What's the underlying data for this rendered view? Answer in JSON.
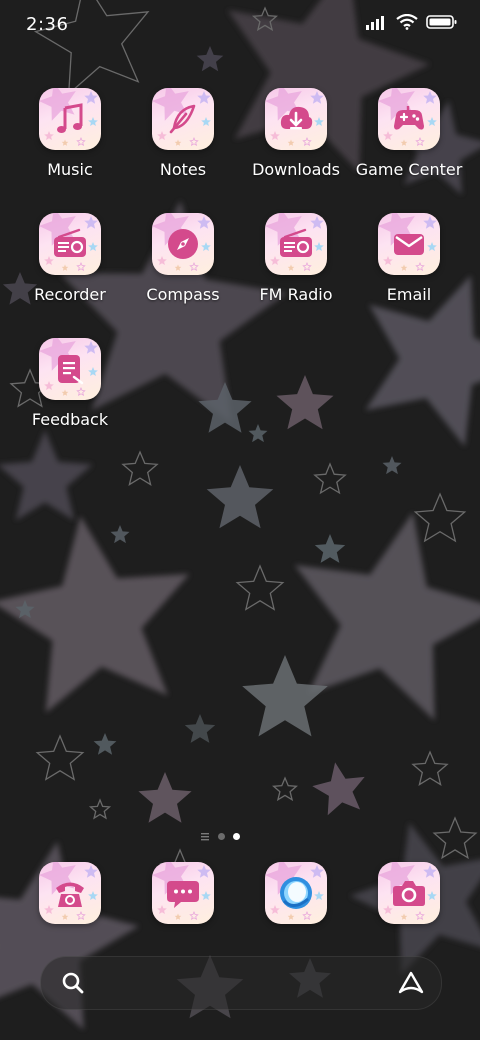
{
  "status_bar": {
    "time": "2:36",
    "icons": [
      "signal-icon",
      "wifi-icon",
      "battery-icon"
    ]
  },
  "home_apps": [
    {
      "label": "Music",
      "icon": "music-note-icon"
    },
    {
      "label": "Notes",
      "icon": "quill-pen-icon"
    },
    {
      "label": "Downloads",
      "icon": "download-cloud-icon"
    },
    {
      "label": "Game Center",
      "icon": "gamepad-icon"
    },
    {
      "label": "Recorder",
      "icon": "radio-icon"
    },
    {
      "label": "Compass",
      "icon": "compass-icon"
    },
    {
      "label": "FM Radio",
      "icon": "radio-icon"
    },
    {
      "label": "Email",
      "icon": "envelope-icon"
    },
    {
      "label": "Feedback",
      "icon": "feedback-icon"
    }
  ],
  "page_indicator": {
    "pages": 3,
    "active": 3,
    "first_is_list": true
  },
  "dock_apps": [
    {
      "name": "Phone",
      "icon": "telephone-icon"
    },
    {
      "name": "Messages",
      "icon": "chat-bubble-icon"
    },
    {
      "name": "Browser",
      "icon": "globe-icon"
    },
    {
      "name": "Camera",
      "icon": "camera-icon"
    }
  ],
  "search_bar": {
    "left_icon": "search-icon",
    "right_icon": "assistant-icon"
  },
  "colors": {
    "accent": "#d44a8c",
    "tile_top": "#f6c7e8",
    "tile_bottom": "#fff0de",
    "background": "#1e1e1e"
  }
}
